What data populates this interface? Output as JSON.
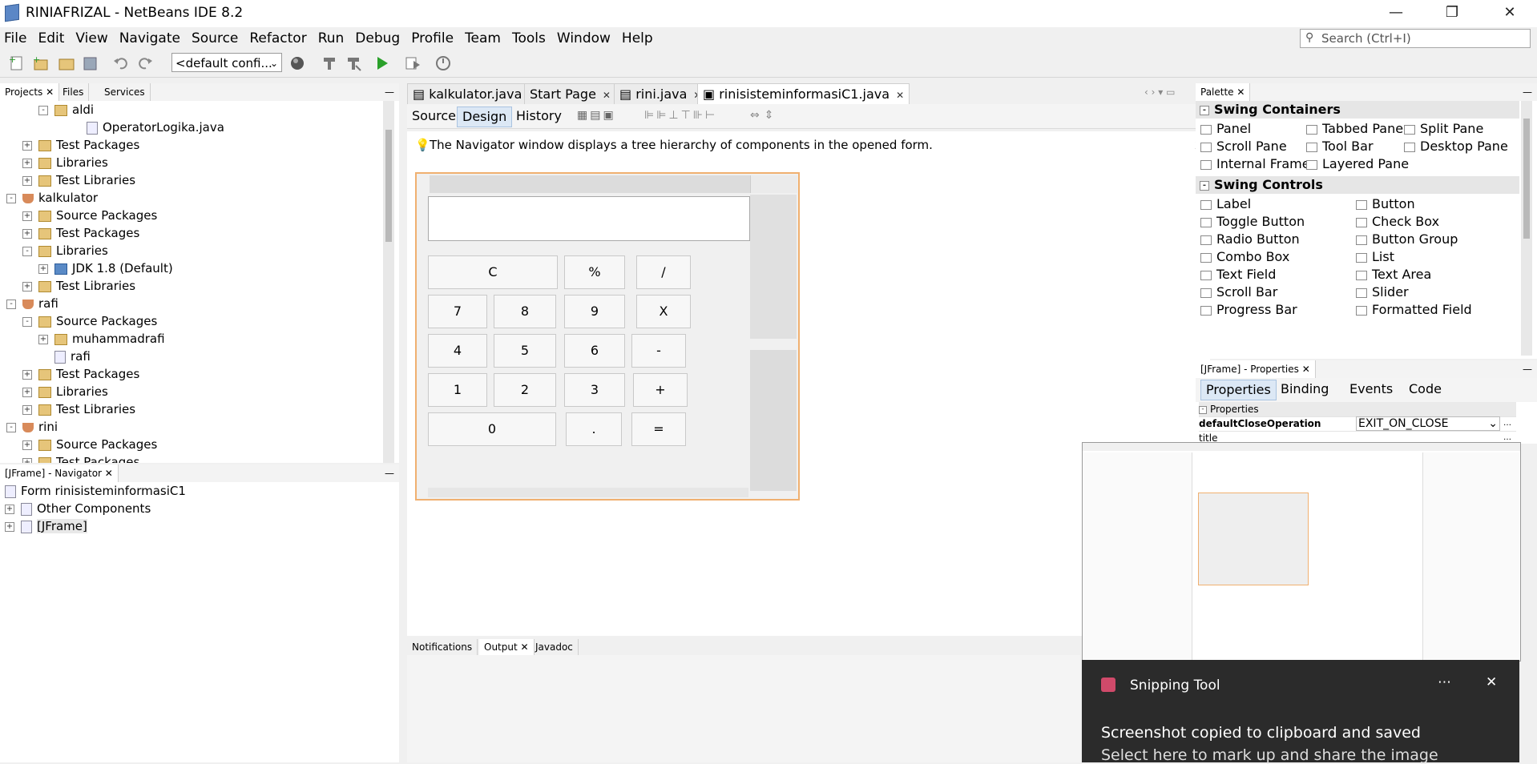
{
  "window": {
    "title": "RINIAFRIZAL - NetBeans IDE 8.2"
  },
  "menu": [
    "File",
    "Edit",
    "View",
    "Navigate",
    "Source",
    "Refactor",
    "Run",
    "Debug",
    "Profile",
    "Team",
    "Tools",
    "Window",
    "Help"
  ],
  "search": {
    "placeholder": "Search (Ctrl+I)"
  },
  "toolbar": {
    "config": "<default confi..."
  },
  "projects_panel": {
    "tabs": [
      "Projects",
      "Files",
      "Services"
    ],
    "rows": [
      {
        "label": "aldi",
        "type": "package",
        "indent": 2,
        "toggle": "-"
      },
      {
        "label": "OperatorLogika.java",
        "type": "file",
        "indent": 4,
        "toggle": ""
      },
      {
        "label": "Test Packages",
        "type": "package",
        "indent": 1,
        "toggle": "+"
      },
      {
        "label": "Libraries",
        "type": "package",
        "indent": 1,
        "toggle": "+"
      },
      {
        "label": "Test Libraries",
        "type": "package",
        "indent": 1,
        "toggle": "+"
      },
      {
        "label": "kalkulator",
        "type": "project",
        "indent": 0,
        "toggle": "-"
      },
      {
        "label": "Source Packages",
        "type": "package",
        "indent": 1,
        "toggle": "+"
      },
      {
        "label": "Test Packages",
        "type": "package",
        "indent": 1,
        "toggle": "+"
      },
      {
        "label": "Libraries",
        "type": "package",
        "indent": 1,
        "toggle": "-"
      },
      {
        "label": "JDK 1.8 (Default)",
        "type": "jdk",
        "indent": 2,
        "toggle": "+"
      },
      {
        "label": "Test Libraries",
        "type": "package",
        "indent": 1,
        "toggle": "+"
      },
      {
        "label": "rafi",
        "type": "project",
        "indent": 0,
        "toggle": "-"
      },
      {
        "label": "Source Packages",
        "type": "package",
        "indent": 1,
        "toggle": "-"
      },
      {
        "label": "muhammadrafi",
        "type": "package",
        "indent": 2,
        "toggle": "+"
      },
      {
        "label": "rafi",
        "type": "file",
        "indent": 2,
        "toggle": ""
      },
      {
        "label": "Test Packages",
        "type": "package",
        "indent": 1,
        "toggle": "+"
      },
      {
        "label": "Libraries",
        "type": "package",
        "indent": 1,
        "toggle": "+"
      },
      {
        "label": "Test Libraries",
        "type": "package",
        "indent": 1,
        "toggle": "+"
      },
      {
        "label": "rini",
        "type": "project",
        "indent": 0,
        "toggle": "-"
      },
      {
        "label": "Source Packages",
        "type": "package",
        "indent": 1,
        "toggle": "+"
      },
      {
        "label": "Test Packages",
        "type": "package",
        "indent": 1,
        "toggle": "+"
      }
    ]
  },
  "navigator": {
    "title": "[JFrame] - Navigator",
    "rows": [
      {
        "label": "Form rinisisteminformasiC1",
        "toggle": ""
      },
      {
        "label": "Other Components",
        "toggle": "+"
      },
      {
        "label": "[JFrame]",
        "toggle": "+"
      }
    ]
  },
  "editor": {
    "tabs": [
      {
        "label": "kalkulator.java"
      },
      {
        "label": "Start Page"
      },
      {
        "label": "rini.java"
      },
      {
        "label": "rinisisteminformasiC1.java"
      }
    ],
    "active_tab": 3,
    "sub_tabs": [
      "Source",
      "Design",
      "History"
    ],
    "active_sub": "Design",
    "info": "The Navigator window displays a tree hierarchy of components in the opened form.",
    "info_close": "x"
  },
  "calculator": {
    "rows": [
      [
        "C",
        "%",
        "/"
      ],
      [
        "7",
        "8",
        "9",
        "X"
      ],
      [
        "4",
        "5",
        "6",
        "-"
      ],
      [
        "1",
        "2",
        "3",
        "+"
      ],
      [
        "0",
        ".",
        "="
      ]
    ]
  },
  "palette": {
    "title": "Palette",
    "categories": [
      {
        "name": "Swing Containers",
        "items": [
          "Panel",
          "Tabbed Pane",
          "Split Pane",
          "Scroll Pane",
          "Tool Bar",
          "Desktop Pane",
          "Internal Frame",
          "Layered Pane"
        ]
      },
      {
        "name": "Swing Controls",
        "items": [
          "Label",
          "Button",
          "Toggle Button",
          "Check Box",
          "Radio Button",
          "Button Group",
          "Combo Box",
          "List",
          "Text Field",
          "Text Area",
          "Scroll Bar",
          "Slider",
          "Progress Bar",
          "Formatted Field"
        ]
      }
    ]
  },
  "properties": {
    "title": "[JFrame] - Properties",
    "tabs": [
      "Properties",
      "Binding",
      "Events",
      "Code"
    ],
    "section": "Properties",
    "rows": [
      {
        "name": "defaultCloseOperation",
        "value": "EXIT_ON_CLOSE"
      },
      {
        "name": "title",
        "value": ""
      }
    ]
  },
  "output_tabs": [
    "Notifications",
    "Output",
    "Javadoc"
  ],
  "snipping": {
    "app": "Snipping Tool",
    "line1": "Screenshot copied to clipboard and saved",
    "line2": "Select here to mark up and share the image"
  }
}
